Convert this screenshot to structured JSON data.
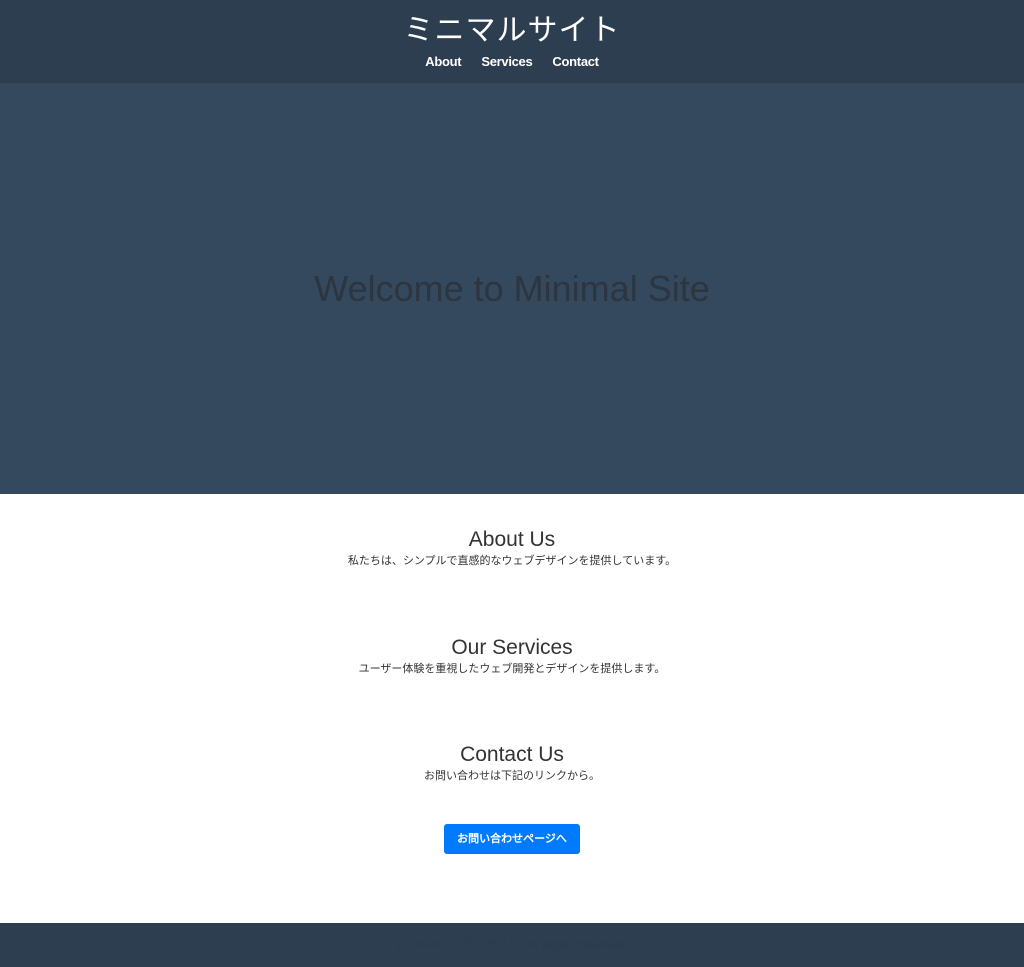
{
  "header": {
    "title": "ミニマルサイト",
    "nav": [
      "About",
      "Services",
      "Contact"
    ]
  },
  "hero": {
    "title": "Welcome to Minimal Site"
  },
  "sections": {
    "about": {
      "heading": "About Us",
      "text": "私たちは、シンプルで直感的なウェブデザインを提供しています。"
    },
    "services": {
      "heading": "Our Services",
      "text": "ユーザー体験を重視したウェブ開発とデザインを提供します。"
    },
    "contact": {
      "heading": "Contact Us",
      "text": "お問い合わせは下記のリンクから。",
      "button_label": "お問い合わせページへ"
    }
  },
  "footer": {
    "text": "© 2024 ミニマルサイト. All rights reserved."
  },
  "colors": {
    "header_bg": "#2c3e50",
    "hero_bg": "#34495e",
    "accent": "#007bff"
  }
}
